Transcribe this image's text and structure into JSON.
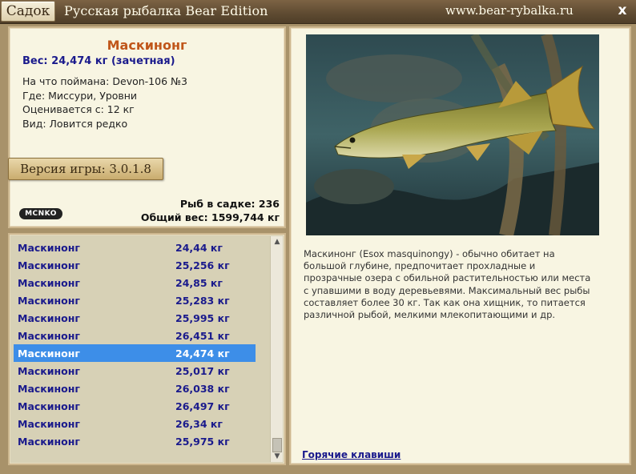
{
  "titlebar": {
    "button_label": "Садок",
    "title": "Русская рыбалка Bear Edition",
    "url": "www.bear-rybalka.ru",
    "close_symbol": "x"
  },
  "fish": {
    "name": "Маскинонг",
    "weight": "Вес: 24,474 кг (зачетная)",
    "bait": "На что поймана: Devon-106 №3",
    "place": "Где: Миссури, Уровни",
    "value": "Оценивается с: 12 кг",
    "rarity": "Вид: Ловится редко"
  },
  "version": "Версия игры: 3.0.1.8",
  "logo_text": "MCNKO",
  "stats": {
    "count": "Рыб в садке: 236",
    "total": "Общий вес: 1599,744 кг"
  },
  "description": "Маскинонг (Esox masquinongy) - обычно обитает на большой глубине, предпочитает прохладные и прозрачные озера с обильной растительностью или места с упавшими в воду деревьевями. Максимальный вес рыбы составляет более 30 кг. Так как она хищник, то питается различной рыбой, мелкими млекопитающими и др.",
  "hotkeys_label": "Горячие клавиши",
  "list": [
    {
      "name": "Маскинонг",
      "weight": "24,44 кг"
    },
    {
      "name": "Маскинонг",
      "weight": "25,256 кг"
    },
    {
      "name": "Маскинонг",
      "weight": "24,85 кг"
    },
    {
      "name": "Маскинонг",
      "weight": "25,283 кг"
    },
    {
      "name": "Маскинонг",
      "weight": "25,995 кг"
    },
    {
      "name": "Маскинонг",
      "weight": "26,451 кг"
    },
    {
      "name": "Маскинонг",
      "weight": "24,474 кг"
    },
    {
      "name": "Маскинонг",
      "weight": "25,017 кг"
    },
    {
      "name": "Маскинонг",
      "weight": "26,038 кг"
    },
    {
      "name": "Маскинонг",
      "weight": "26,497 кг"
    },
    {
      "name": "Маскинонг",
      "weight": "26,34 кг"
    },
    {
      "name": "Маскинонг",
      "weight": "25,975 кг"
    }
  ],
  "selected_index": 6,
  "colors": {
    "accent_title": "#c0561a",
    "list_text": "#1a1a8c",
    "selected_bg": "#3d8ee8"
  },
  "scroll_symbols": {
    "up": "▲",
    "down": "▼"
  }
}
